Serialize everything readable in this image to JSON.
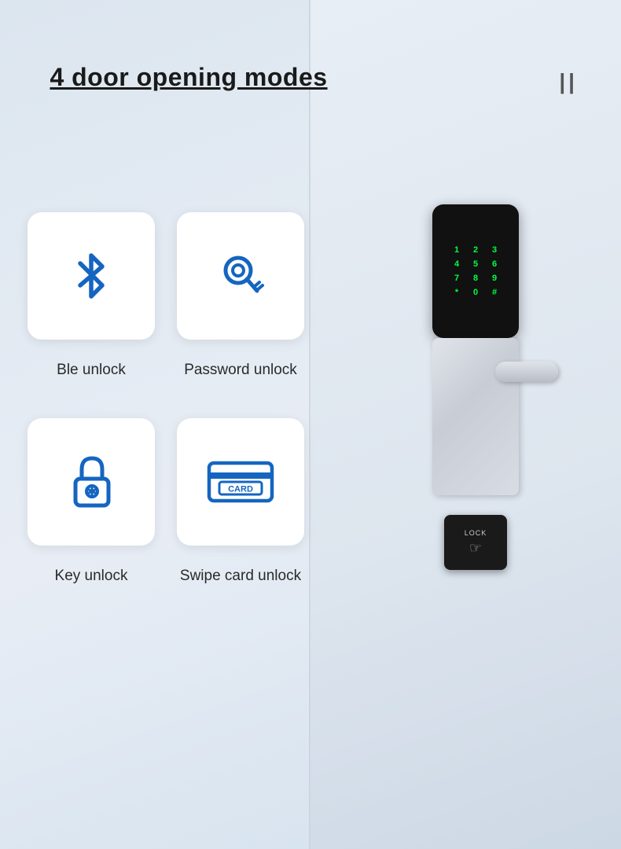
{
  "page": {
    "title": "4 door opening modes",
    "pause_icon": "||"
  },
  "modes": [
    {
      "id": "ble",
      "label": "Ble unlock"
    },
    {
      "id": "password",
      "label": "Password unlock"
    },
    {
      "id": "key",
      "label": "Key unlock"
    },
    {
      "id": "card",
      "label": "Swipe card unlock"
    }
  ],
  "keypad": {
    "rows": [
      [
        "1",
        "2",
        "3"
      ],
      [
        "4",
        "5",
        "6"
      ],
      [
        "7",
        "8",
        "9"
      ],
      [
        "*",
        "0",
        "#"
      ]
    ]
  },
  "lock_button": {
    "label": "LOCK"
  },
  "card_text": "CARD"
}
